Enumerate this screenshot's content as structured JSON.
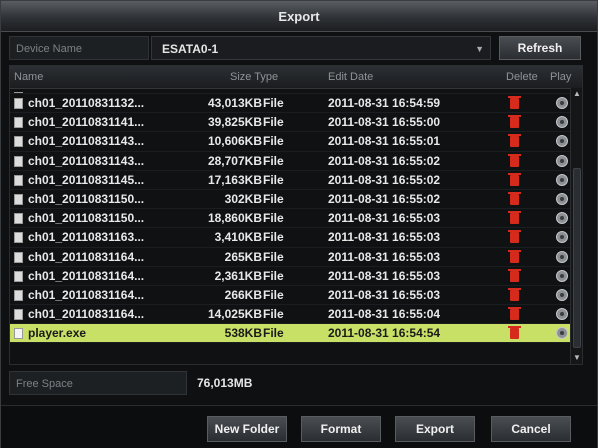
{
  "window": {
    "title": "Export"
  },
  "device": {
    "label": "Device Name",
    "value": "ESATA0-1",
    "refresh_label": "Refresh"
  },
  "table": {
    "headers": {
      "name": "Name",
      "size_type": "Size Type",
      "edit_date": "Edit Date",
      "delete": "Delete",
      "play": "Play"
    },
    "rows": [
      {
        "name": "ch01_20110831132...",
        "size": "43,013KB",
        "type": "File",
        "date": "2011-08-31 16:54:59"
      },
      {
        "name": "ch01_20110831141...",
        "size": "39,825KB",
        "type": "File",
        "date": "2011-08-31 16:55:00"
      },
      {
        "name": "ch01_20110831143...",
        "size": "10,606KB",
        "type": "File",
        "date": "2011-08-31 16:55:01"
      },
      {
        "name": "ch01_20110831143...",
        "size": "28,707KB",
        "type": "File",
        "date": "2011-08-31 16:55:02"
      },
      {
        "name": "ch01_20110831145...",
        "size": "17,163KB",
        "type": "File",
        "date": "2011-08-31 16:55:02"
      },
      {
        "name": "ch01_20110831150...",
        "size": "302KB",
        "type": "File",
        "date": "2011-08-31 16:55:02"
      },
      {
        "name": "ch01_20110831150...",
        "size": "18,860KB",
        "type": "File",
        "date": "2011-08-31 16:55:03"
      },
      {
        "name": "ch01_20110831163...",
        "size": "3,410KB",
        "type": "File",
        "date": "2011-08-31 16:55:03"
      },
      {
        "name": "ch01_20110831164...",
        "size": "265KB",
        "type": "File",
        "date": "2011-08-31 16:55:03"
      },
      {
        "name": "ch01_20110831164...",
        "size": "2,361KB",
        "type": "File",
        "date": "2011-08-31 16:55:03"
      },
      {
        "name": "ch01_20110831164...",
        "size": "266KB",
        "type": "File",
        "date": "2011-08-31 16:55:03"
      },
      {
        "name": "ch01_20110831164...",
        "size": "14,025KB",
        "type": "File",
        "date": "2011-08-31 16:55:04"
      },
      {
        "name": "player.exe",
        "size": "538KB",
        "type": "File",
        "date": "2011-08-31 16:54:54",
        "selected": true
      }
    ]
  },
  "free_space": {
    "label": "Free Space",
    "value": "76,013MB"
  },
  "buttons": {
    "new_folder": "New Folder",
    "format": "Format",
    "export": "Export",
    "cancel": "Cancel"
  },
  "colors": {
    "selected_row": "#c8e066",
    "delete_icon": "#d62b1c"
  },
  "icons": {
    "file": "file-icon",
    "delete": "trash-icon",
    "play": "play-icon"
  }
}
